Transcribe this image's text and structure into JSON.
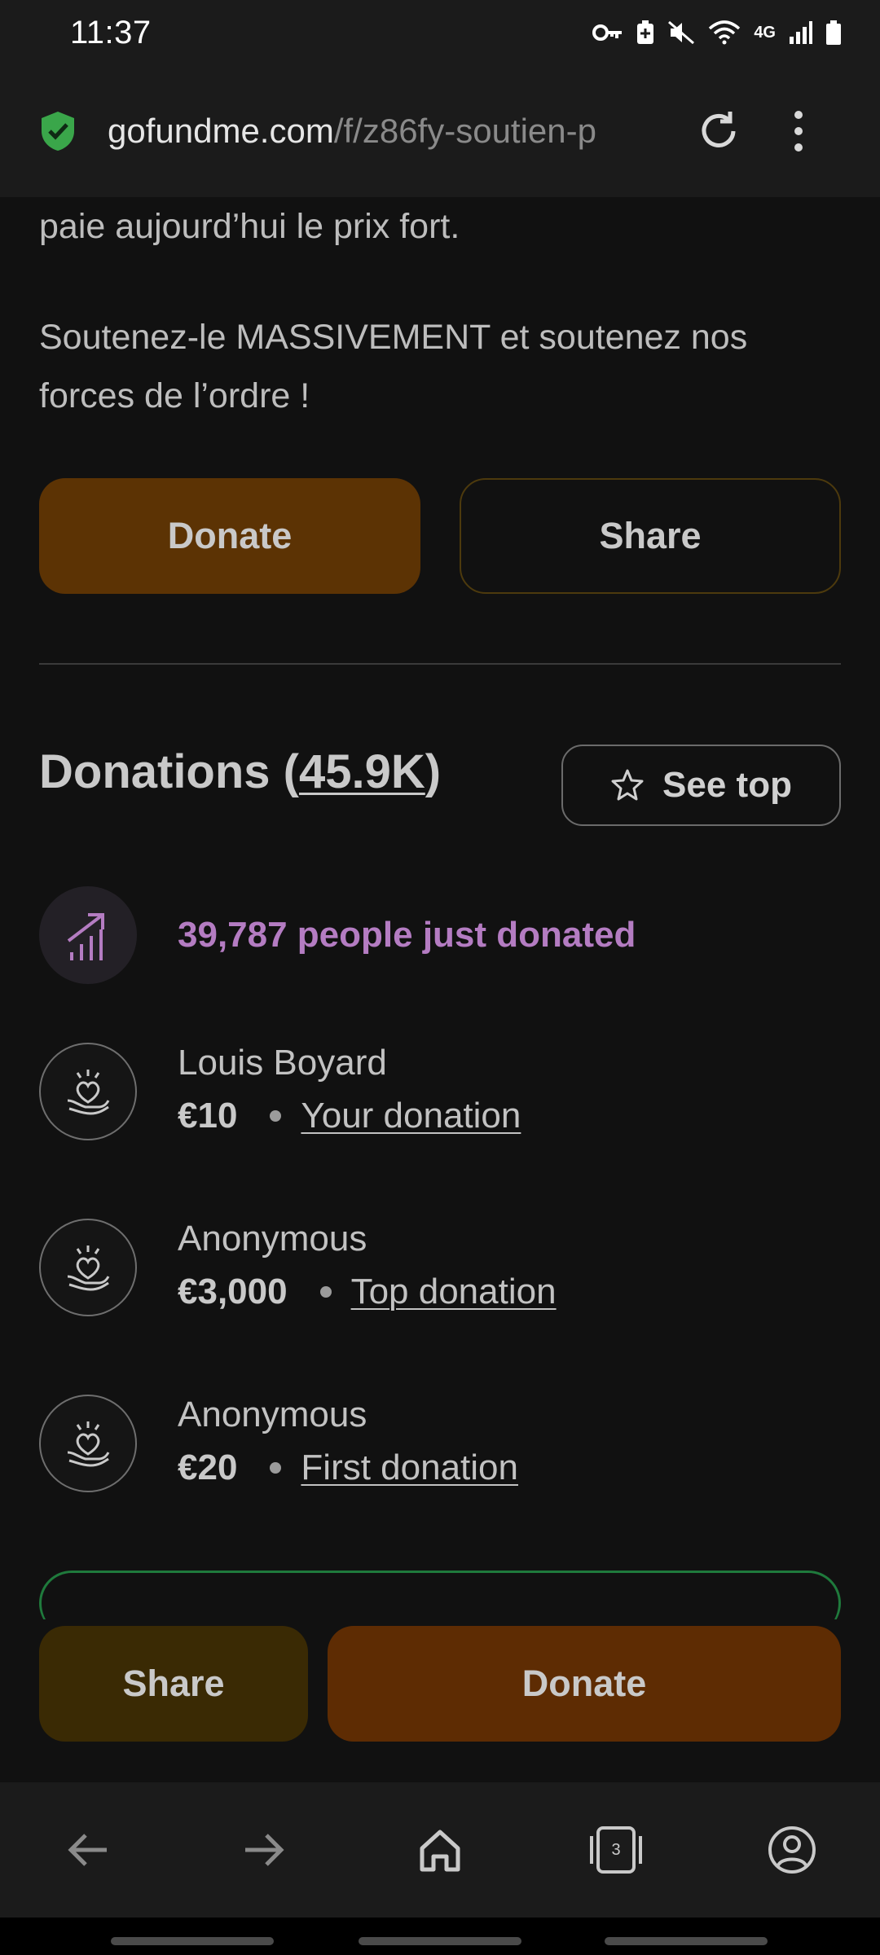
{
  "status_bar": {
    "time": "11:37",
    "network": "4G"
  },
  "browser": {
    "url_domain": "gofundme.com",
    "url_path": "/f/z86fy-soutien-p",
    "tab_count": "3"
  },
  "content": {
    "paragraph_1": "paie aujourd’hui le prix fort.",
    "paragraph_2": "Soutenez-le MASSIVEMENT et soutenez nos forces de l’ordre !",
    "donate_label": "Donate",
    "share_label": "Share"
  },
  "donations": {
    "title_prefix": "Donations (",
    "count": "45.9K",
    "title_suffix": ")",
    "see_top_label": "See top",
    "trend_text": "39,787 people just donated",
    "items": [
      {
        "name": "Louis Boyard",
        "amount": "€10",
        "tag": "Your donation"
      },
      {
        "name": "Anonymous",
        "amount": "€3,000",
        "tag": "Top donation"
      },
      {
        "name": "Anonymous",
        "amount": "€20",
        "tag": "First donation"
      }
    ]
  },
  "bottom_actions": {
    "share_label": "Share",
    "donate_label": "Donate"
  },
  "colors": {
    "background": "#111111",
    "donate": "#5c3304",
    "share_bottom": "#3a2a04",
    "trend_purple": "#b47cc2",
    "shield_green": "#3aa64a"
  },
  "icons": [
    "key-icon",
    "battery-saver-icon",
    "mute-icon",
    "wifi-icon",
    "signal-icon",
    "battery-icon",
    "shield-icon",
    "reload-icon",
    "more-vert-icon",
    "star-icon",
    "trending-up-icon",
    "heart-hand-icon",
    "back-arrow-icon",
    "forward-arrow-icon",
    "home-icon",
    "tabs-icon",
    "account-icon"
  ]
}
